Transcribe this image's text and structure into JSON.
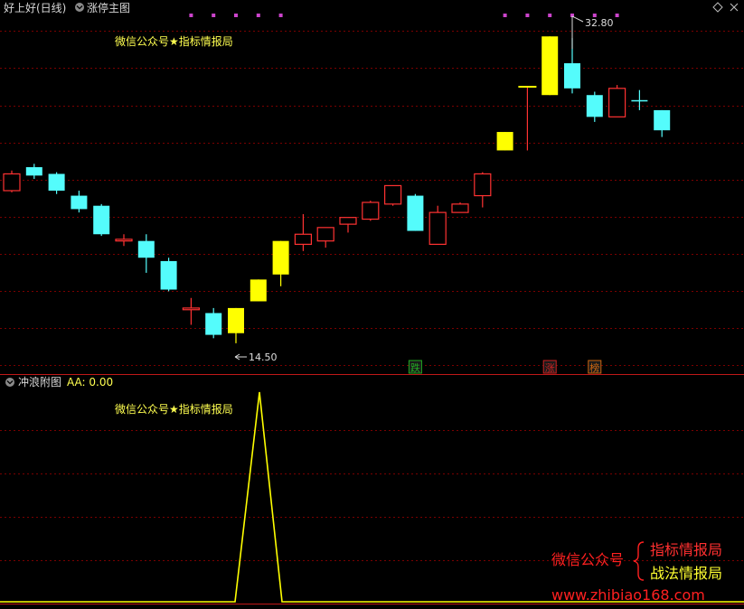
{
  "header": {
    "stock_title": "好上好(日线)",
    "indicator_name": "涨停主图"
  },
  "main_panel": {
    "watermark": "微信公众号★指标情报局",
    "high_label": "32.80",
    "low_label": "14.50",
    "markers": [
      {
        "text": "跌",
        "color": "#22aa22",
        "candle": 18
      },
      {
        "text": "涨",
        "color": "#cc2222",
        "candle": 24
      },
      {
        "text": "榜",
        "color": "#cc6611",
        "candle": 26
      }
    ],
    "top_dots_candles": [
      8,
      9,
      10,
      11,
      12,
      22,
      23,
      24,
      25,
      26,
      27
    ]
  },
  "sub_panel": {
    "title": "冲浪附图",
    "value_label": "AA: 0.00",
    "watermark": "微信公众号★指标情报局"
  },
  "brand": {
    "left": "微信公众号",
    "right_top": "指标情报局",
    "right_bottom": "战法情报局",
    "url": "www.zhibiao168.com"
  },
  "colors": {
    "up": "#ff3232",
    "down": "#54fcfc",
    "limit_up": "#ffff00",
    "grid": "#7a0000",
    "axis": "#c01818",
    "watermark": "#ffff50",
    "brand_red": "#ff2020",
    "brand_yellow": "#ffff30",
    "text": "#c8c8c8"
  },
  "chart_data": [
    {
      "type": "candlestick",
      "title": "涨停主图",
      "price_range": [
        13.2,
        34.0
      ],
      "high_price": 32.8,
      "low_price": 14.5,
      "candles": [
        {
          "o": 24.6,
          "h": 24.8,
          "l": 23.5,
          "c": 23.6,
          "kind": "up"
        },
        {
          "o": 25.0,
          "h": 25.2,
          "l": 24.3,
          "c": 24.5,
          "kind": "down"
        },
        {
          "o": 24.6,
          "h": 24.7,
          "l": 23.4,
          "c": 23.6,
          "kind": "down"
        },
        {
          "o": 23.3,
          "h": 23.6,
          "l": 22.3,
          "c": 22.5,
          "kind": "down"
        },
        {
          "o": 22.7,
          "h": 22.8,
          "l": 20.9,
          "c": 21.0,
          "kind": "down"
        },
        {
          "o": 20.7,
          "h": 21.0,
          "l": 20.3,
          "c": 20.6,
          "kind": "up"
        },
        {
          "o": 20.6,
          "h": 21.0,
          "l": 18.7,
          "c": 19.6,
          "kind": "down"
        },
        {
          "o": 19.4,
          "h": 19.6,
          "l": 17.6,
          "c": 17.7,
          "kind": "down"
        },
        {
          "o": 16.5,
          "h": 17.2,
          "l": 15.6,
          "c": 16.6,
          "kind": "up"
        },
        {
          "o": 16.3,
          "h": 16.6,
          "l": 14.8,
          "c": 15.0,
          "kind": "down"
        },
        {
          "o": 15.1,
          "h": 16.6,
          "l": 14.5,
          "c": 16.6,
          "kind": "limit_up"
        },
        {
          "o": 17.0,
          "h": 18.3,
          "l": 17.0,
          "c": 18.3,
          "kind": "limit_up"
        },
        {
          "o": 18.6,
          "h": 20.6,
          "l": 17.9,
          "c": 20.6,
          "kind": "limit_up"
        },
        {
          "o": 20.4,
          "h": 22.2,
          "l": 20.0,
          "c": 21.0,
          "kind": "up"
        },
        {
          "o": 20.6,
          "h": 21.4,
          "l": 20.2,
          "c": 21.4,
          "kind": "up"
        },
        {
          "o": 21.6,
          "h": 21.9,
          "l": 21.1,
          "c": 22.0,
          "kind": "up"
        },
        {
          "o": 21.9,
          "h": 23.0,
          "l": 21.8,
          "c": 22.9,
          "kind": "up"
        },
        {
          "o": 22.8,
          "h": 23.9,
          "l": 22.7,
          "c": 23.9,
          "kind": "up"
        },
        {
          "o": 23.3,
          "h": 23.4,
          "l": 21.2,
          "c": 21.2,
          "kind": "down"
        },
        {
          "o": 20.4,
          "h": 22.7,
          "l": 20.4,
          "c": 22.3,
          "kind": "up"
        },
        {
          "o": 22.3,
          "h": 22.9,
          "l": 22.3,
          "c": 22.8,
          "kind": "up"
        },
        {
          "o": 23.3,
          "h": 24.7,
          "l": 22.6,
          "c": 24.6,
          "kind": "up"
        },
        {
          "o": 26.0,
          "h": 27.1,
          "l": 26.0,
          "c": 27.1,
          "kind": "limit_up"
        },
        {
          "o": 29.8,
          "h": 29.8,
          "l": 26.0,
          "c": 29.8,
          "kind": "limit_up_line"
        },
        {
          "o": 29.3,
          "h": 32.8,
          "l": 29.3,
          "c": 32.8,
          "kind": "limit_up"
        },
        {
          "o": 31.2,
          "h": 32.7,
          "l": 29.4,
          "c": 29.7,
          "kind": "down"
        },
        {
          "o": 29.3,
          "h": 29.5,
          "l": 27.7,
          "c": 28.0,
          "kind": "down"
        },
        {
          "o": 28.0,
          "h": 29.9,
          "l": 28.0,
          "c": 29.7,
          "kind": "up"
        },
        {
          "o": 29.0,
          "h": 29.6,
          "l": 28.4,
          "c": 29.0,
          "kind": "down"
        },
        {
          "o": 28.4,
          "h": 28.4,
          "l": 26.8,
          "c": 27.2,
          "kind": "down"
        }
      ]
    },
    {
      "type": "line",
      "title": "冲浪附图",
      "series": [
        {
          "name": "AA",
          "current": 0.0
        }
      ],
      "points": [
        [
          0,
          0
        ],
        [
          260,
          0
        ],
        [
          287,
          1
        ],
        [
          312,
          0
        ],
        [
          823,
          0
        ]
      ]
    }
  ]
}
